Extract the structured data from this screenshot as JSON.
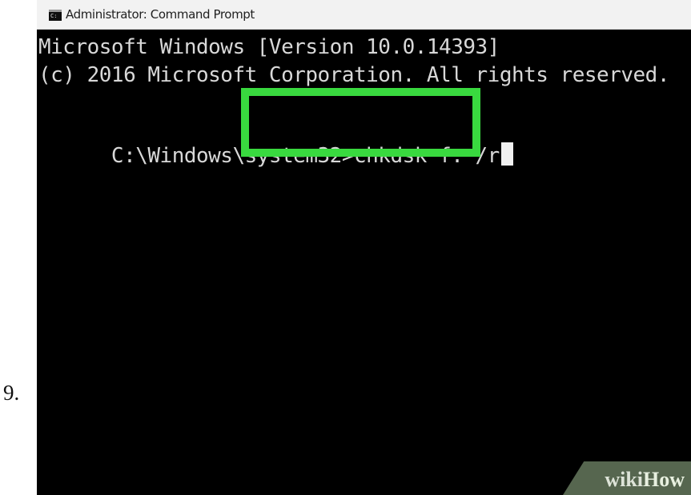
{
  "step": {
    "number": "9."
  },
  "window": {
    "title": "Administrator: Command Prompt",
    "icon": "command-prompt-icon"
  },
  "console": {
    "line1": "Microsoft Windows [Version 10.0.14393]",
    "line2": "(c) 2016 Microsoft Corporation. All rights reserved.",
    "prompt": "C:\\Windows\\system32>",
    "command": "chkdsk f: /r"
  },
  "highlight": {
    "color": "#39d93f"
  },
  "watermark": {
    "wiki": "wiki",
    "how": "How"
  }
}
